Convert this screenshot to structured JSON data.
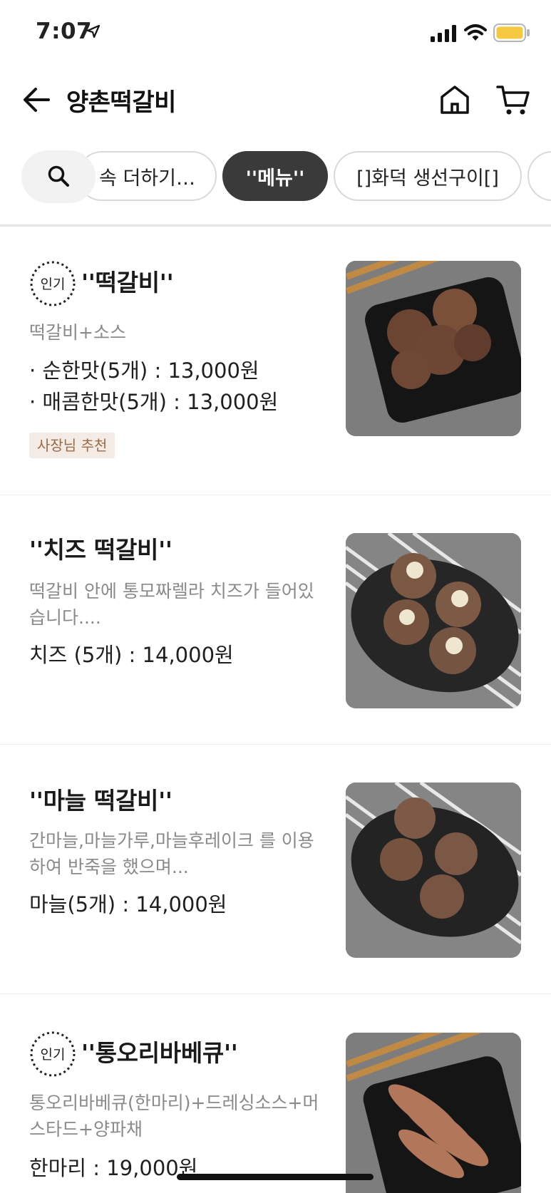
{
  "status_bar": {
    "time": "7:07",
    "battery_color": "#f5c842"
  },
  "header": {
    "title": "양촌떡갈비",
    "back_icon": "arrow-left-icon",
    "home_icon": "home-icon",
    "cart_icon": "cart-icon"
  },
  "tabs": {
    "search_icon": "search-icon",
    "items": [
      {
        "label": "속 더하기…",
        "active": false
      },
      {
        "label": "''메뉴''",
        "active": true
      },
      {
        "label": "[]화덕 생선구이[]",
        "active": false
      },
      {
        "label": "\"",
        "active": false
      }
    ]
  },
  "menu_items": [
    {
      "popular_badge": "인기",
      "name": "''떡갈비''",
      "description": "떡갈비+소스",
      "prices": [
        "· 순한맛(5개) : 13,000원",
        "· 매콤한맛(5개) : 13,000원"
      ],
      "recommend_badge": "사장님 추천"
    },
    {
      "name": "''치즈 떡갈비''",
      "description": "떡갈비 안에 통모짜렐라 치즈가 들어있습니다....",
      "prices": [
        "치즈 (5개) : 14,000원"
      ]
    },
    {
      "name": "''마늘 떡갈비''",
      "description": "간마늘,마늘가루,마늘후레이크 를 이용하여 반죽을 했으며...",
      "prices": [
        "마늘(5개) : 14,000원"
      ]
    },
    {
      "popular_badge": "인기",
      "name": "''통오리바베큐''",
      "description": "통오리바베큐(한마리)+드레싱소스+머스타드+양파채",
      "prices": [
        "한마리 : 19,000원"
      ]
    }
  ]
}
